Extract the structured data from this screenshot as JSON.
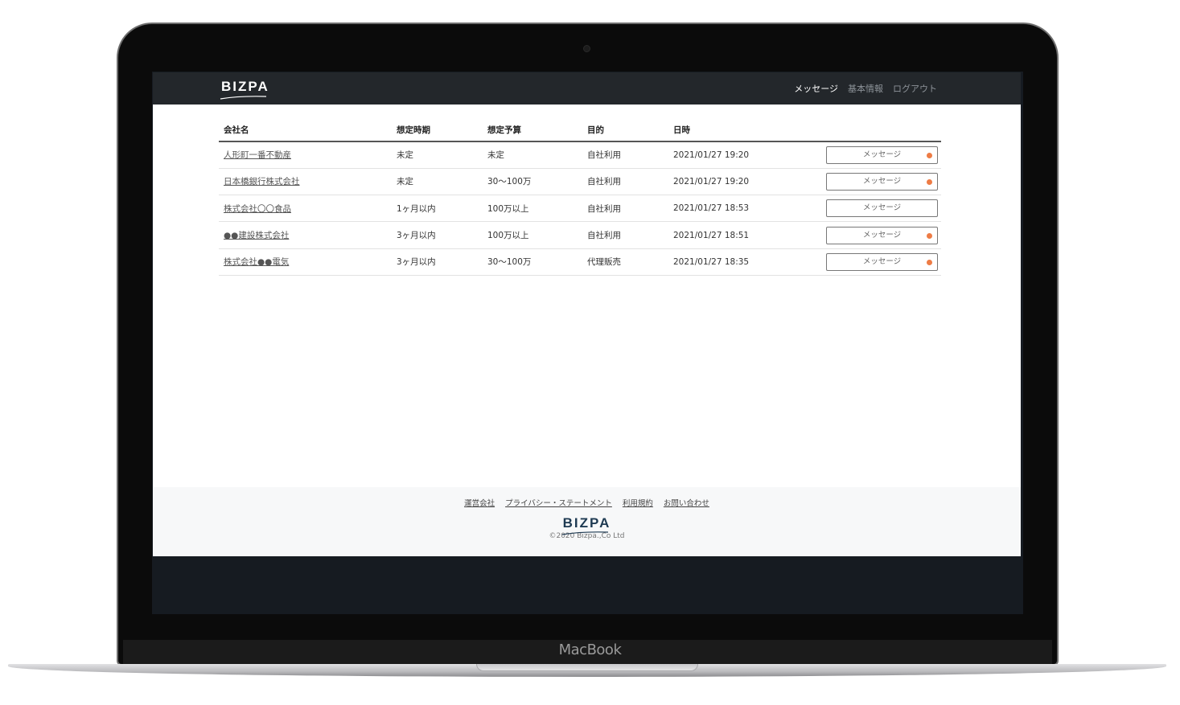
{
  "device": {
    "brand": "MacBook"
  },
  "navbar": {
    "logo": "BIZPA",
    "links": [
      {
        "label": "メッセージ",
        "active": true
      },
      {
        "label": "基本情報",
        "active": false
      },
      {
        "label": "ログアウト",
        "active": false
      }
    ]
  },
  "table": {
    "headers": [
      "会社名",
      "想定時期",
      "想定予算",
      "目的",
      "日時"
    ],
    "rows": [
      {
        "company": "人形町一番不動産",
        "timing": "未定",
        "budget": "未定",
        "purpose": "自社利用",
        "datetime": "2021/01/27 19:20",
        "button": "メッセージ",
        "unread": true
      },
      {
        "company": "日本橋銀行株式会社",
        "timing": "未定",
        "budget": "30～100万",
        "purpose": "自社利用",
        "datetime": "2021/01/27 19:20",
        "button": "メッセージ",
        "unread": true
      },
      {
        "company": "株式会社〇〇食品",
        "timing": "1ヶ月以内",
        "budget": "100万以上",
        "purpose": "自社利用",
        "datetime": "2021/01/27 18:53",
        "button": "メッセージ",
        "unread": false
      },
      {
        "company": "●●建設株式会社",
        "timing": "3ヶ月以内",
        "budget": "100万以上",
        "purpose": "自社利用",
        "datetime": "2021/01/27 18:51",
        "button": "メッセージ",
        "unread": true
      },
      {
        "company": "株式会社●●電気",
        "timing": "3ヶ月以内",
        "budget": "30～100万",
        "purpose": "代理販売",
        "datetime": "2021/01/27 18:35",
        "button": "メッセージ",
        "unread": true
      }
    ]
  },
  "footer": {
    "links": [
      "運営会社",
      "プライバシー・ステートメント",
      "利用規約",
      "お問い合わせ"
    ],
    "logo": "BIZPA",
    "copyright": "©2020 Bizpa.,Co Ltd"
  },
  "colors": {
    "navbar_bg": "#23272b",
    "unread_dot": "#ee7c45",
    "footer_logo": "#1e3a52"
  }
}
